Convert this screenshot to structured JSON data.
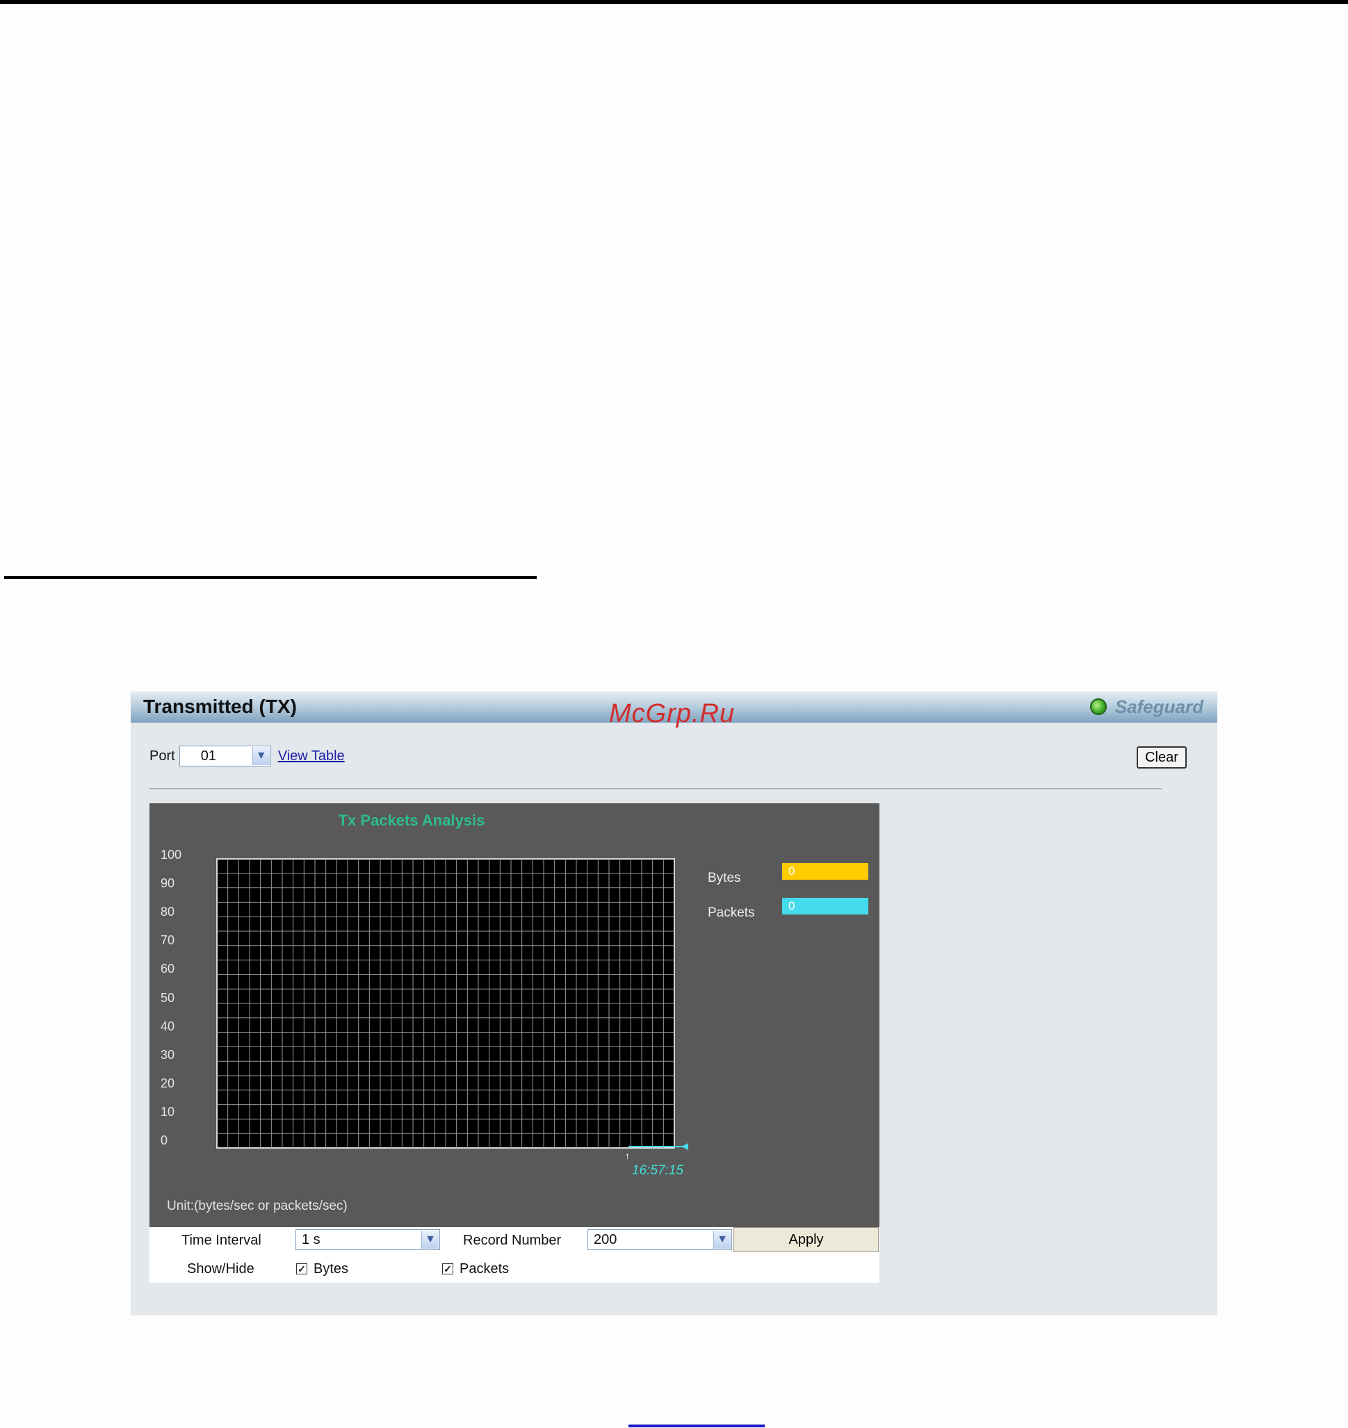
{
  "panel": {
    "title": "Transmitted (TX)",
    "watermark": "McGrp.Ru",
    "safeguard_label": "Safeguard",
    "safeguard_icon": "green-status-dot-icon"
  },
  "port": {
    "label": "Port",
    "value": "01",
    "view_table_link": "View Table"
  },
  "clear_button": "Clear",
  "chart_data": {
    "type": "line",
    "title": "Tx Packets Analysis",
    "ylim": [
      0,
      100
    ],
    "y_ticks": [
      "100",
      "90",
      "80",
      "70",
      "60",
      "50",
      "40",
      "30",
      "20",
      "10",
      "0"
    ],
    "grid": true,
    "time_marker": "16:57:15",
    "unit_note": "Unit:(bytes/sec or packets/sec)",
    "series": [
      {
        "name": "Bytes",
        "current_value": "0",
        "color": "#ffcc00"
      },
      {
        "name": "Packets",
        "current_value": "0",
        "color": "#44dcec"
      }
    ]
  },
  "controls": {
    "time_interval_label": "Time Interval",
    "time_interval_value": "1 s",
    "record_number_label": "Record Number",
    "record_number_value": "200",
    "apply_button": "Apply",
    "show_hide_label": "Show/Hide",
    "show_bytes_label": "Bytes",
    "show_packets_label": "Packets",
    "show_bytes_checked": true,
    "show_packets_checked": true
  }
}
